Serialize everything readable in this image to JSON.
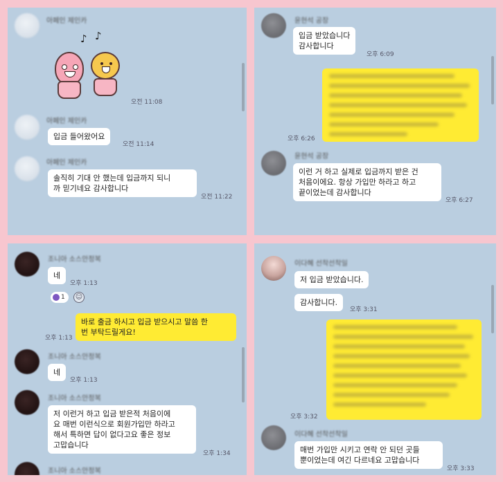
{
  "colors": {
    "frame": "#f7c6cf",
    "chat_bg": "#bacee0",
    "bubble_in": "#ffffff",
    "bubble_out": "#ffeb33"
  },
  "panel_tl": {
    "time_1": "오전 11:08",
    "msg_1": "입금 들어왔어요",
    "time_2": "오전 11:14",
    "msg_2": "솔직히 기대 안 했는데 입금까지 되니\n까 믿기네요 감사합니다",
    "time_3": "오전 11:22",
    "sticker_icon": "character-sticker-icon"
  },
  "panel_tr": {
    "msg_1": "입금 받았습니다\n감사합니다",
    "time_1": "오후 6:09",
    "time_2": "오후 6:26",
    "msg_3": "이런 거 하고 실제로 입금까지 받은 건\n처음이에요. 항상 가입만 하라고 하고\n끝이었는데 감사합니다",
    "time_3": "오후 6:27"
  },
  "panel_bl": {
    "msg_1": "네",
    "time_1": "오후 1:13",
    "reaction_count": "1",
    "msg_2": "바로 출금 하시고 입금 받으시고 말씀 한\n번 부탁드릴게요!",
    "time_2": "오후 1:13",
    "msg_3": "네",
    "time_3": "오후 1:13",
    "msg_4": "저 이런거 하고 입금 받은적 처음이에\n요 매번 이런식으로 회원가입만 하라고\n해서 특하면 답이 없다고요 좋은 정보\n고맙습니다",
    "time_4": "오후 1:34"
  },
  "panel_br": {
    "msg_1": "저 입금 받았습니다.",
    "msg_2": "감사합니다.",
    "time_2": "오후 3:31",
    "time_3": "오후 3:32",
    "msg_4": "매번 가입만 시키고 연락 안 되던 곳들\n뿐이었는데 여긴 다르네요 고맙습니다",
    "time_4": "오후 3:33"
  }
}
